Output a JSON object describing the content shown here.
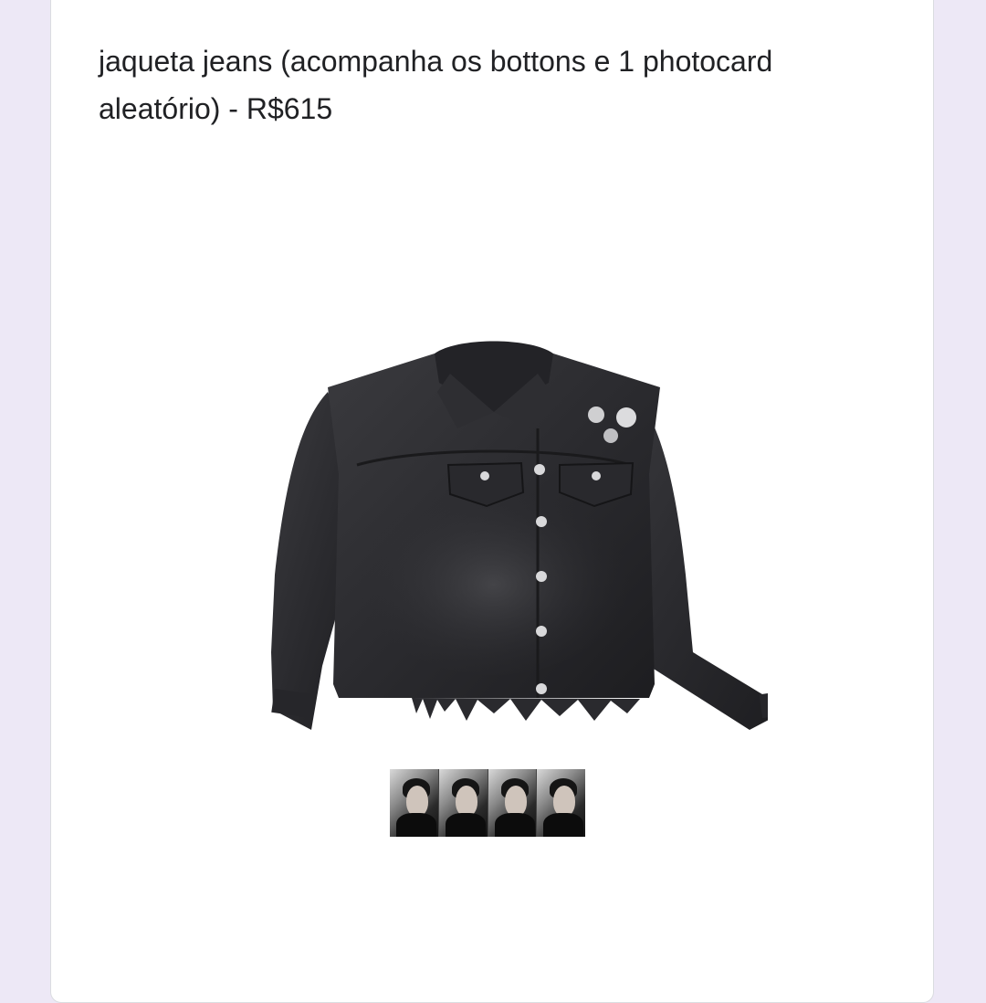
{
  "question": {
    "title": "jaqueta jeans (acompanha os bottons e 1 photocard aleatório) - R$615"
  },
  "colors": {
    "page_background": "#ede8f6",
    "card_background": "#ffffff",
    "text": "#202124"
  },
  "images": {
    "product": "black denim jacket with buttons",
    "photocards": "photocard strip"
  }
}
